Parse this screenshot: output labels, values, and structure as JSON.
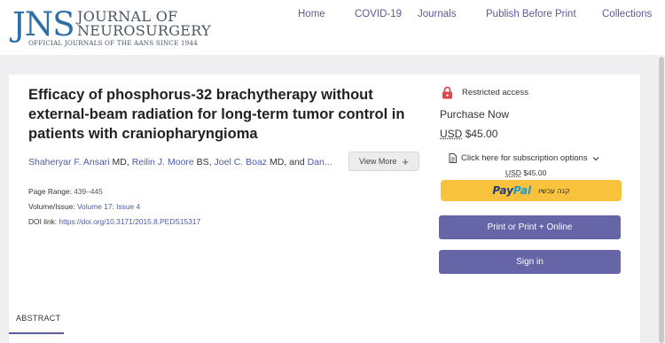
{
  "logo": {
    "jns": "JNS",
    "line1": "JOURNAL OF",
    "line2": "NEUROSURGERY",
    "tagline": "OFFICIAL JOURNALS OF THE AANS SINCE 1944"
  },
  "nav": [
    "Home",
    "COVID-19",
    "Journals",
    "Publish Before Print",
    "Collections"
  ],
  "article": {
    "title": "Efficacy of phosphorus-32 brachytherapy without external-beam radiation for long-term tumor control in patients with craniopharyngioma",
    "authors": [
      {
        "name": "Shaheryar F. Ansari",
        "degree": " MD, "
      },
      {
        "name": "Reilin J. Moore",
        "degree": " BS, "
      },
      {
        "name": "Joel C. Boaz",
        "degree": " MD, and "
      },
      {
        "name": "Dan...",
        "degree": ""
      }
    ],
    "view_more": "View More",
    "page_range_label": "Page Range:",
    "page_range": "439–445",
    "volume_label": "Volume/Issue:",
    "volume": "Volume 17: Issue 4",
    "doi_label": "DOI link:",
    "doi": "https://doi.org/10.3171/2015.8.PEDS15317"
  },
  "purchase": {
    "restricted": "Restricted access",
    "purchase_now": "Purchase Now",
    "currency": "USD",
    "price": "$45.00",
    "subscription": "Click here for subscription options",
    "paypal_a": "Pay",
    "paypal_b": "Pal",
    "paypal_hebrew": "קנה עכשיו",
    "print_button": "Print or Print + Online",
    "signin_button": "Sign in"
  },
  "tabs": {
    "abstract": "ABSTRACT"
  },
  "colors": {
    "accent": "#6665a7",
    "link": "#4d5aa6",
    "paypal": "#f9c23c",
    "lock": "#e04848"
  }
}
